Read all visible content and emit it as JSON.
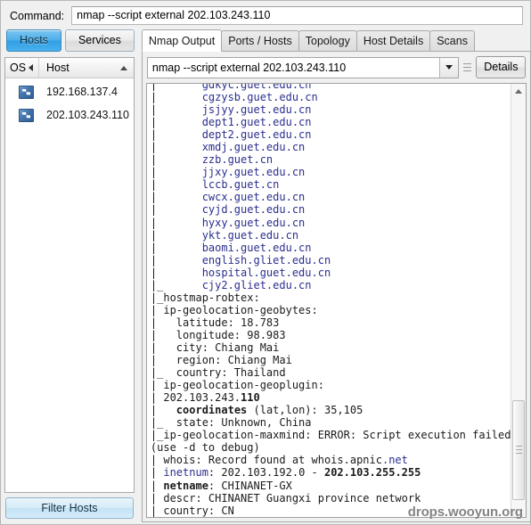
{
  "command": {
    "label": "Command:",
    "value": "nmap --script external 202.103.243.110"
  },
  "toggle": {
    "hosts": "Hosts",
    "services": "Services"
  },
  "host_list": {
    "col_os": "OS",
    "col_host": "Host",
    "rows": [
      {
        "host": "192.168.137.4",
        "icon": "windows-os-icon"
      },
      {
        "host": "202.103.243.110",
        "icon": "windows-os-icon"
      }
    ],
    "filter_button": "Filter Hosts"
  },
  "tabs": [
    {
      "label": "Nmap Output",
      "active": true
    },
    {
      "label": "Ports / Hosts",
      "active": false
    },
    {
      "label": "Topology",
      "active": false
    },
    {
      "label": "Host Details",
      "active": false
    },
    {
      "label": "Scans",
      "active": false
    }
  ],
  "output_toolbar": {
    "combo_value": "nmap --script external 202.103.243.110",
    "combo_arrow_icon": "chevron-down-icon",
    "grip_icon": "grip-handle-icon",
    "details_button": "Details"
  },
  "terminal": {
    "lines": [
      {
        "t": "|       gdkyc.guet.edu.cn",
        "c": "blue"
      },
      {
        "t": "|       cgzysb.guet.edu.cn",
        "c": "blue"
      },
      {
        "t": "|       jsjyy.guet.edu.cn",
        "c": "blue"
      },
      {
        "t": "|       dept1.guet.edu.cn",
        "c": "blue"
      },
      {
        "t": "|       dept2.guet.edu.cn",
        "c": "blue"
      },
      {
        "t": "|       xmdj.guet.edu.cn",
        "c": "blue"
      },
      {
        "t": "|       zzb.guet.cn",
        "c": "blue"
      },
      {
        "t": "|       jjxy.guet.edu.cn",
        "c": "blue"
      },
      {
        "t": "|       lccb.guet.cn",
        "c": "blue"
      },
      {
        "t": "|       cwcx.guet.edu.cn",
        "c": "blue"
      },
      {
        "t": "|       cyjd.guet.edu.cn",
        "c": "blue"
      },
      {
        "t": "|       hyxy.guet.edu.cn",
        "c": "blue"
      },
      {
        "t": "|       ykt.guet.edu.cn",
        "c": "blue"
      },
      {
        "t": "|       baomi.guet.edu.cn",
        "c": "blue"
      },
      {
        "t": "|       english.gliet.edu.cn",
        "c": "blue"
      },
      {
        "t": "|       hospital.guet.edu.cn",
        "c": "blue"
      },
      {
        "t": "|_      cjy2.gliet.edu.cn",
        "c": "blue"
      },
      {
        "t": "|_hostmap-robtex:",
        "c": "dark"
      },
      {
        "t": "| ip-geolocation-geobytes:",
        "c": "dark"
      },
      {
        "t": "|   latitude: 18.783",
        "c": "dark"
      },
      {
        "t": "|   longitude: 98.983",
        "c": "dark"
      },
      {
        "t": "|   city: Chiang Mai",
        "c": "dark"
      },
      {
        "t": "|   region: Chiang Mai",
        "c": "dark"
      },
      {
        "t": "|_  country: Thailand",
        "c": "dark"
      },
      {
        "t": "| ip-geolocation-geoplugin:",
        "c": "dark"
      },
      {
        "t": "| 202.103.243.110",
        "c": "dark-bold-tail"
      },
      {
        "t": "|   coordinates (lat,lon): 35,105",
        "c": "dark-bold-head"
      },
      {
        "t": "|_  state: Unknown, China",
        "c": "dark"
      },
      {
        "t": "|_ip-geolocation-maxmind: ERROR: Script execution failed",
        "c": "dark"
      },
      {
        "t": "(use -d to debug)",
        "c": "dark"
      },
      {
        "t": "| whois: Record found at whois.apnic.net",
        "c": "dark-whois"
      },
      {
        "t": "| inetnum: 202.103.192.0 - 202.103.255.255",
        "c": "inetnum"
      },
      {
        "t": "| netname: CHINANET-GX",
        "c": "dark-bold-head"
      },
      {
        "t": "| descr: CHINANET Guangxi province network",
        "c": "dark"
      },
      {
        "t": "| country: CN",
        "c": "dark"
      }
    ]
  },
  "watermark": "drops.wooyun.org"
}
